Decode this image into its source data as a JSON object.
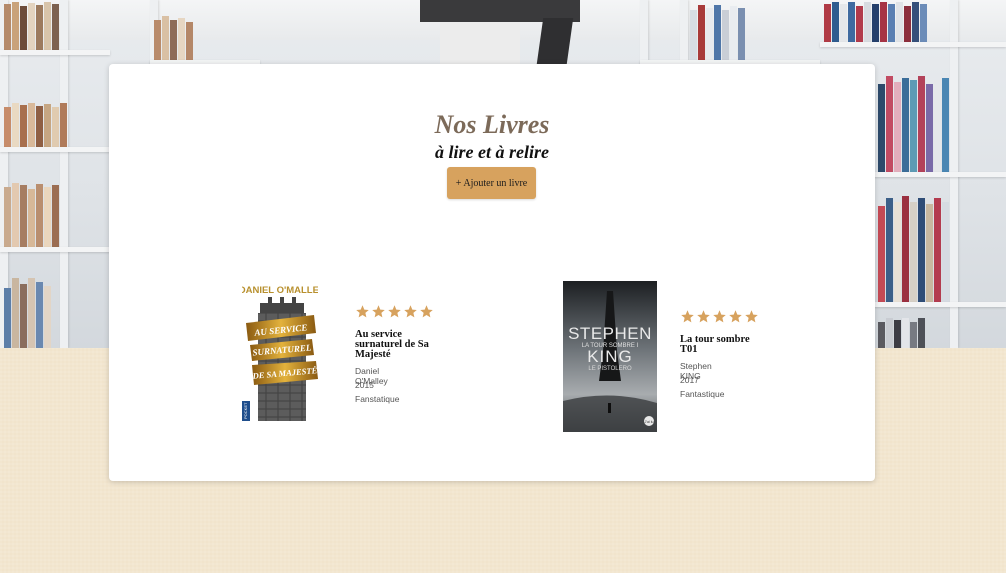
{
  "header": {
    "title": "Nos Livres",
    "subtitle": "à lire et à relire",
    "add_button_label": "+ Ajouter un livre"
  },
  "theme": {
    "accent": "#d7a25e",
    "star_color": "#d7a25e",
    "title_color": "#7c6a59",
    "page_background": "#f1e4cc"
  },
  "books": [
    {
      "title": "Au service surnaturel de Sa Majesté",
      "author": "Daniel O'Malley",
      "year": "2015",
      "genre": "Fanstatique",
      "rating": 5,
      "cover": {
        "author_line": "DANIEL O'MALLEY",
        "title_lines": [
          "AU SERVICE",
          "SURNATUREL",
          "DE SA MAJESTÉ"
        ],
        "publisher": "POCKET"
      }
    },
    {
      "title": "La tour sombre T01",
      "author": "Stephen KING",
      "year": "2017",
      "genre": "Fantastique",
      "rating": 5,
      "cover": {
        "author_first": "STEPHEN",
        "author_last": "KING",
        "series": "LA TOUR SOMBRE I",
        "subtitle": "LE PISTOLERO",
        "publisher": "J'ai lu"
      }
    }
  ]
}
